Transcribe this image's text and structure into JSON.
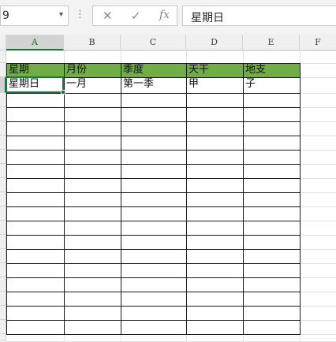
{
  "namebox": {
    "value": "9",
    "arrow": "▾"
  },
  "formula_bar": {
    "dots": "⋮",
    "cancel": "✕",
    "confirm": "✓",
    "fx": "fx",
    "content": "星期日"
  },
  "columns": [
    "A",
    "B",
    "C",
    "D",
    "E",
    "F"
  ],
  "selected_cell": "A2",
  "table": {
    "header_fill": "#70ad47",
    "headers": [
      "星期",
      "月份",
      "季度",
      "天干",
      "地支"
    ],
    "row1": [
      "星期日",
      "一月",
      "第一季",
      "甲",
      "子"
    ]
  }
}
